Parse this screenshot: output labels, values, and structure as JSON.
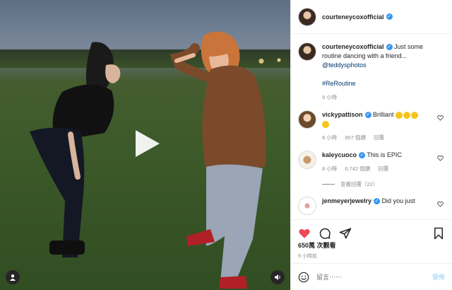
{
  "post": {
    "author": "courteneycoxofficial",
    "verified": true
  },
  "caption": {
    "author": "courteneycoxofficial",
    "text": "Just some routine dancing with a friend...",
    "mention": "@teddysphotos",
    "hashtag": "#ReRoutine",
    "time": "9 小時"
  },
  "comments": [
    {
      "user": "vickypattison",
      "verified": true,
      "text": "Brilliant",
      "emoji_count": 4,
      "time": "8 小時",
      "likes": "807 個讚",
      "reply": "回覆"
    },
    {
      "user": "kaleycuoco",
      "verified": true,
      "text": "This is EPIC",
      "time": "8 小時",
      "likes": "6,742 個讚",
      "reply": "回覆",
      "view_replies": "查看回覆（22）"
    },
    {
      "user": "jenmeyerjewelry",
      "verified": true,
      "text": "Did you just"
    }
  ],
  "stats": {
    "views": "650萬 次觀看",
    "posted": "9 小時前"
  },
  "add_comment": {
    "placeholder": "留言⋯⋯",
    "post_label": "發佈"
  },
  "icons": [
    "play-icon",
    "user-tag-icon",
    "speaker-icon",
    "heart-icon",
    "comment-icon",
    "share-icon",
    "bookmark-icon",
    "smiley-icon",
    "verified-icon"
  ],
  "colors": {
    "like_red": "#ed4956",
    "verified_blue": "#3897f0",
    "link": "#00376b",
    "post_disabled": "#b2dffc"
  }
}
